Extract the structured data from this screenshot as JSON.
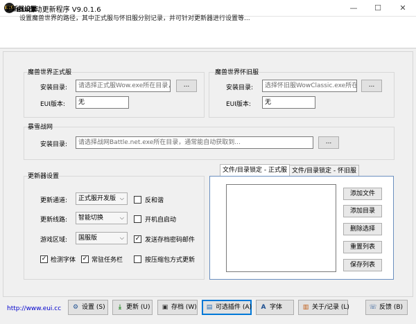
{
  "window": {
    "icon_text": "EUI",
    "title": "EUI自动更新程序 V9.0.1.6",
    "minimize": "—",
    "maximize": "☐",
    "close": "✕"
  },
  "header": {
    "title": "更新器设置",
    "description": "设置魔兽世界的路径，其中正式服与怀旧服分别记录，并可针对更新器进行设置等..."
  },
  "retail": {
    "title": "魔兽世界正式服",
    "install_label": "安装目录:",
    "install_placeholder": "请选择正式服Wow.exe所在目录，",
    "browse": "...",
    "version_label": "EUI版本:",
    "version_value": "无"
  },
  "classic": {
    "title": "魔兽世界怀旧服",
    "install_label": "安装目录:",
    "install_placeholder": "选择怀旧服WowClassic.exe所在目",
    "browse": "...",
    "version_label": "EUI版本:",
    "version_value": "无"
  },
  "battlenet": {
    "title": "暴雪战网",
    "install_label": "安装目录:",
    "install_placeholder": "请选择战网Battle.net.exe所在目录，通常能自动获取到...",
    "browse": "..."
  },
  "updater": {
    "title": "更新器设置",
    "channel_label": "更新通道:",
    "channel_value": "正式服开发版",
    "route_label": "更新线路:",
    "route_value": "智能切换",
    "region_label": "游戏区域:",
    "region_value": "国服版",
    "checkboxes": [
      {
        "label": "反和谐",
        "checked": false
      },
      {
        "label": "开机自启动",
        "checked": false
      },
      {
        "label": "发送存档密码邮件",
        "checked": true
      },
      {
        "label": "检测字体",
        "checked": true
      },
      {
        "label": "常驻任务栏",
        "checked": true
      },
      {
        "label": "按压缩包方式更新",
        "checked": false
      }
    ]
  },
  "lock_tabs": {
    "tabs": [
      "文件/目录锁定 - 正式服",
      "文件/目录锁定 - 怀旧服"
    ],
    "active": 0,
    "buttons": [
      "添加文件",
      "添加目录",
      "删除选择",
      "重置列表",
      "保存列表"
    ]
  },
  "footer": {
    "link": "http://www.eui.cc",
    "buttons": {
      "settings": "设置 (S)",
      "update": "更新 (U)",
      "archive": "存档 (W)",
      "plugins": "可选插件 (A)",
      "font": "字体",
      "about": "关于/记录 (L)",
      "feedback": "反馈 (B)"
    }
  },
  "colors": {
    "link": "#0000cc",
    "focus": "#0078d7",
    "tab_border": "#6a8fbf"
  },
  "icons": {
    "settings": "gear-icon",
    "update": "download-icon",
    "archive": "save-icon",
    "plugins": "plugin-icon",
    "font": "font-icon",
    "about": "book-icon",
    "feedback": "feedback-icon"
  }
}
